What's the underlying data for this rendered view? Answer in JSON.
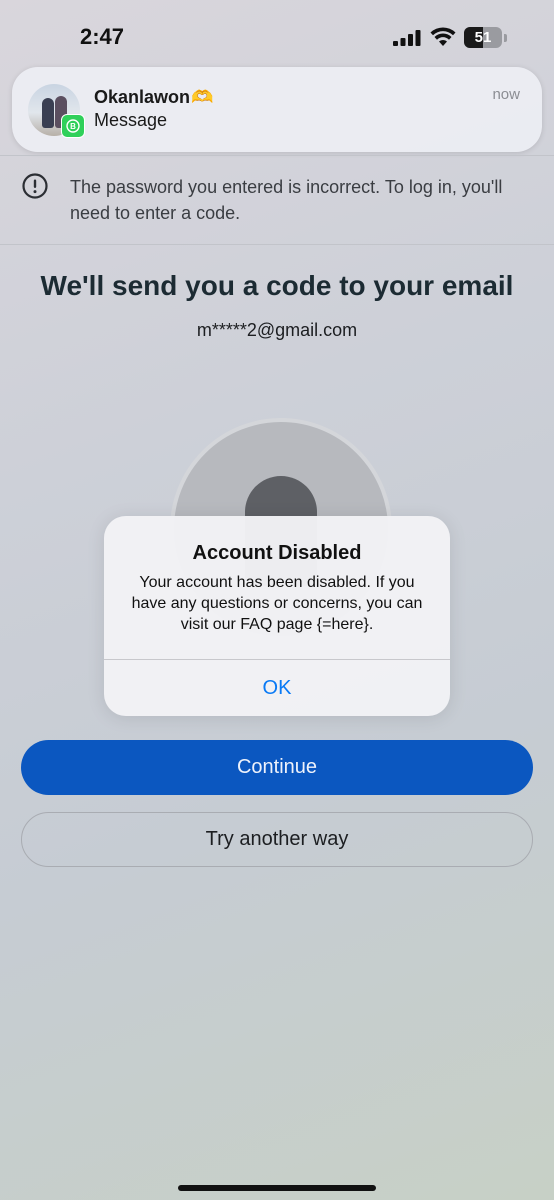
{
  "status_bar": {
    "time": "2:47",
    "battery_level": "51",
    "battery_fraction": 0.51
  },
  "notification": {
    "sender": "Okanlawon",
    "sender_emoji": "🫶",
    "message": "Message",
    "time": "now",
    "app_badge_letter": "B",
    "app_icon": "whatsapp-business-icon"
  },
  "error_banner": {
    "icon": "exclamation-circle-icon",
    "text": "The password you entered is incorrect. To log in, you'll need to enter a code."
  },
  "main": {
    "headline": "We'll send you a code to your email",
    "email": "m*****2@gmail.com",
    "profile_icon": "profile-placeholder-icon"
  },
  "alert": {
    "title": "Account Disabled",
    "message": "Your account has been disabled.  If you have any questions or concerns, you can visit our FAQ page {=here}.",
    "ok_label": "OK"
  },
  "actions": {
    "continue_label": "Continue",
    "try_another_label": "Try another way"
  },
  "colors": {
    "primary_button": "#0b57c0",
    "alert_action": "#0a7af5",
    "badge_green": "#2fd05a"
  }
}
